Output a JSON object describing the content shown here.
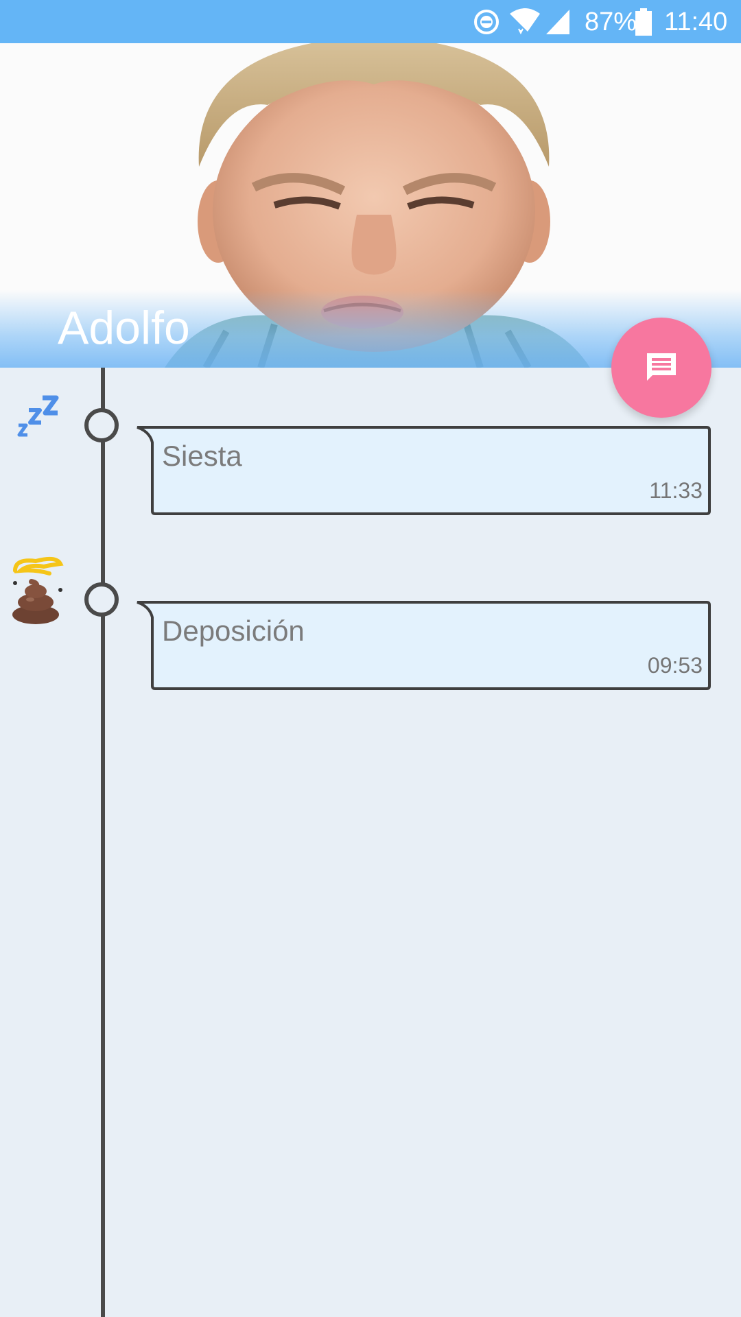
{
  "status_bar": {
    "battery_percent": "87%",
    "time": "11:40",
    "icons": [
      "do-not-disturb-icon",
      "wifi-icon",
      "cell-signal-icon",
      "battery-icon"
    ]
  },
  "header": {
    "title": "Adolfo",
    "photo": "child-profile-photo"
  },
  "fab": {
    "icon": "comment-icon",
    "color": "#f7779f"
  },
  "timeline": {
    "events": [
      {
        "label": "Siesta",
        "time": "11:33",
        "icon": "sleep-zzz-icon"
      },
      {
        "label": "Deposición",
        "time": "09:53",
        "icon": "poop-icon"
      }
    ]
  },
  "colors": {
    "status_bar": "#64b5f6",
    "background": "#e8eff6",
    "bubble_fill": "#e3f2fd",
    "timeline": "#4a4a4a",
    "fab": "#f7779f"
  }
}
